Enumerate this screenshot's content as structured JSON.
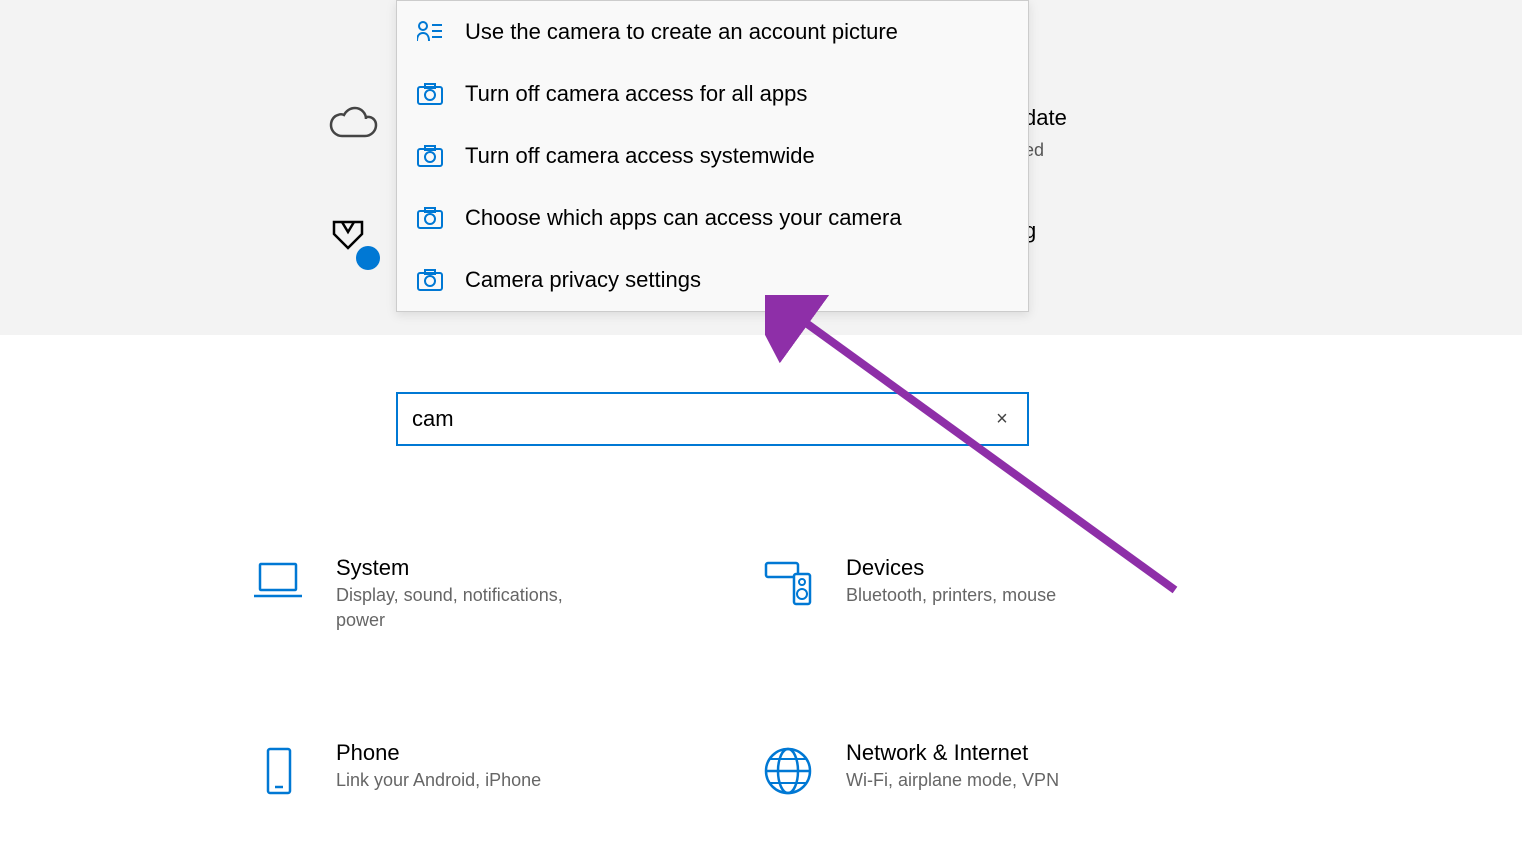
{
  "search": {
    "value": "cam",
    "clear": "×"
  },
  "dropdown": {
    "items": [
      {
        "icon": "person-list",
        "label": "Use the camera to create an account picture"
      },
      {
        "icon": "camera",
        "label": "Turn off camera access for all apps"
      },
      {
        "icon": "camera",
        "label": "Turn off camera access systemwide"
      },
      {
        "icon": "camera",
        "label": "Choose which apps can access your camera"
      },
      {
        "icon": "camera",
        "label": "Camera privacy settings"
      }
    ]
  },
  "partial_text": {
    "right1": "date",
    "right2": "ed",
    "right3": "g"
  },
  "categories": {
    "system": {
      "title": "System",
      "subtitle": "Display, sound, notifications, power"
    },
    "devices": {
      "title": "Devices",
      "subtitle": "Bluetooth, printers, mouse"
    },
    "phone": {
      "title": "Phone",
      "subtitle": "Link your Android, iPhone"
    },
    "network": {
      "title": "Network & Internet",
      "subtitle": "Wi-Fi, airplane mode, VPN"
    }
  },
  "watermark": ""
}
